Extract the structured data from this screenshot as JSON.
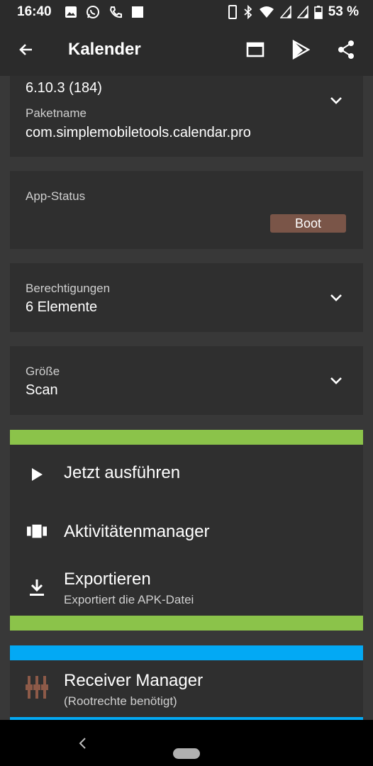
{
  "status_bar": {
    "time": "16:40",
    "battery_percent": "53 %",
    "icons_left": [
      "image-icon",
      "whatsapp-icon",
      "call-icon",
      "square-icon"
    ],
    "icons_right": [
      "phone-icon",
      "bluetooth-icon",
      "wifi-icon",
      "signal-icon",
      "signal-icon",
      "battery-icon"
    ]
  },
  "app_bar": {
    "title": "Kalender",
    "actions": [
      "window-icon",
      "play-store-icon",
      "share-icon"
    ]
  },
  "version_card": {
    "version": "6.10.3 (184)",
    "package_label": "Paketname",
    "package_value": "com.simplemobiletools.calendar.pro"
  },
  "status_card": {
    "label": "App-Status",
    "badge": "Boot",
    "badge_color": "#7a5548"
  },
  "permissions_card": {
    "label": "Berechtigungen",
    "value": "6 Elemente"
  },
  "size_card": {
    "label": "Größe",
    "value": "Scan"
  },
  "actions_group": {
    "accent_color": "#8bc34a",
    "items": [
      {
        "title": "Jetzt ausführen",
        "icon": "play-icon"
      },
      {
        "title": "Aktivitätenmanager",
        "icon": "carousel-icon"
      },
      {
        "title": "Exportieren",
        "subtitle": "Exportiert die APK-Datei",
        "icon": "download-icon"
      }
    ]
  },
  "root_group": {
    "accent_color": "#03a9f4",
    "items": [
      {
        "title": "Receiver Manager",
        "subtitle": "(Rootrechte benötigt)",
        "icon": "receiver-icon"
      }
    ]
  }
}
